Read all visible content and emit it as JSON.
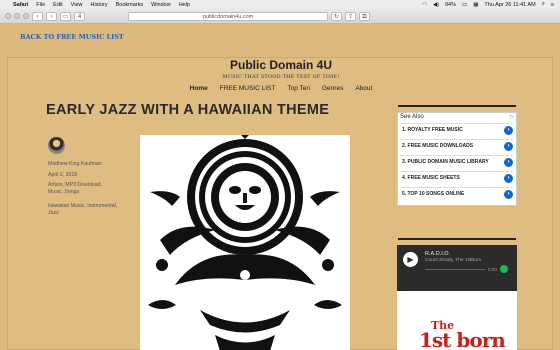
{
  "menubar": {
    "app": "Safari",
    "items": [
      "File",
      "Edit",
      "View",
      "History",
      "Bookmarks",
      "Window",
      "Help"
    ],
    "battery": "94%",
    "datetime": "Thu Apr 26  11:41 AM"
  },
  "browser": {
    "url": "publicdomain4u.com",
    "badge": "4"
  },
  "page": {
    "back_link": "BACK TO FREE MUSIC LIST",
    "site_title": "Public Domain 4U",
    "site_tagline": "MUSIC THAT STOOD THE TEST OF TIME!",
    "nav": [
      "Home",
      "FREE MUSIC LIST",
      "Top Ten",
      "Genres",
      "About"
    ],
    "post_title": "EARLY JAZZ WITH A HAWAIIAN THEME",
    "author": "Matthew King Kaufman",
    "date": "April 2, 2018",
    "categories": "Artists, MP3 Download, Music, Songs",
    "tags": "Hawaiian Music, Instrumental, Jazz"
  },
  "sidebar": {
    "see_also_title": "See Also",
    "ad_choices": "▷",
    "links": [
      "1. ROYALTY FREE MUSIC",
      "2. FREE MUSIC DOWNLOADS",
      "3. PUBLIC DOMAIN MUSIC LIBRARY",
      "4. FREE MUSIC SHEETS",
      "5. TOP 10 SONGS ONLINE"
    ],
    "radio_title": "R.A.D.I.O.",
    "radio_song": "Count Slowly, The 1stBorn",
    "radio_time": "0:00",
    "image_text_1": "The",
    "image_text_2": "1st born"
  },
  "colors": {
    "page_bg": "#ddb980",
    "link": "#1f63b5",
    "chevron": "#1467c8"
  }
}
